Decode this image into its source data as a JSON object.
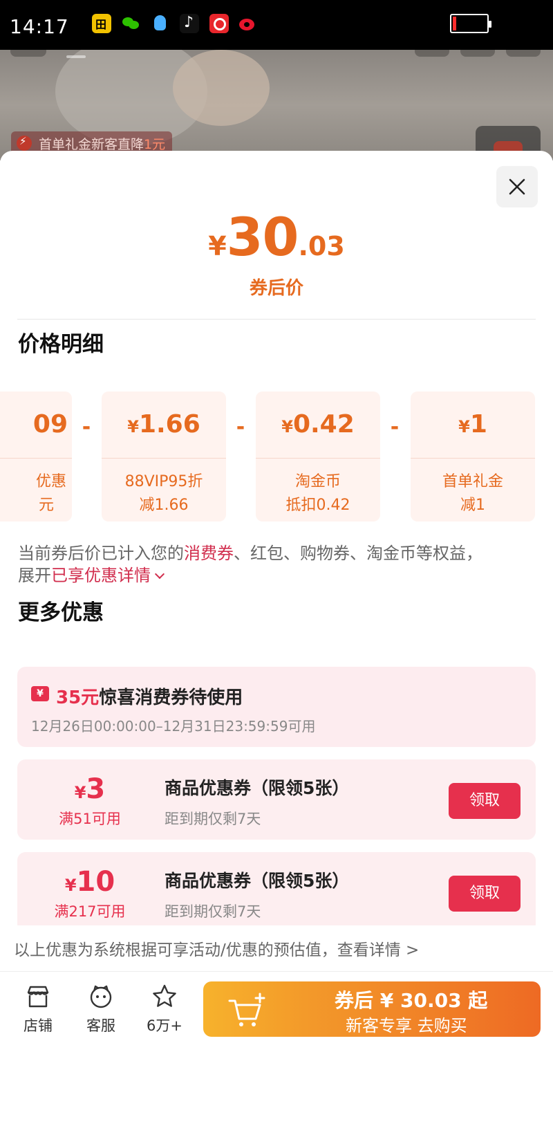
{
  "status_bar": {
    "time": "14:17"
  },
  "background": {
    "promo_tag_text": "首单礼金新客直降",
    "promo_tag_amount": "1元"
  },
  "price_summary": {
    "currency": "¥",
    "integer": "30",
    "decimal": ".03",
    "label": "券后价"
  },
  "detail": {
    "title": "价格明细",
    "cards": [
      {
        "value": "09",
        "line1": "优惠",
        "line2": "元"
      },
      {
        "value": "1.66",
        "currency": "¥",
        "line1": "88VIP95折",
        "line2": "减1.66"
      },
      {
        "value": "0.42",
        "currency": "¥",
        "line1": "淘金币",
        "line2": "抵扣0.42"
      },
      {
        "value": "1",
        "currency": "¥",
        "line1": "首单礼金",
        "line2": "减1"
      }
    ],
    "operator": "-"
  },
  "note": {
    "part1": "当前券后价已计入您的",
    "highlight1": "消费券",
    "part2": "、红包、购物券、淘金币等权益，",
    "part3": "展开",
    "highlight2": "已享优惠详情"
  },
  "more": {
    "title": "更多优惠",
    "surprise": {
      "ticket_symbol": "¥",
      "amount": "35元",
      "title": "惊喜消费券待使用",
      "period": "12月26日00:00:00–12月31日23:59:59可用"
    },
    "coupons": [
      {
        "currency": "¥",
        "value": "3",
        "condition": "满51可用",
        "title": "商品优惠券（限领5张）",
        "expiry": "距到期仅剩7天",
        "button": "领取"
      },
      {
        "currency": "¥",
        "value": "10",
        "condition": "满217可用",
        "title": "商品优惠券（限领5张）",
        "expiry": "距到期仅剩7天",
        "button": "领取"
      }
    ]
  },
  "disclaimer": "以上优惠为系统根据可享活动/优惠的预估值，查看详情 >",
  "bottom_bar": {
    "store": "店铺",
    "service": "客服",
    "favorites": "6万+",
    "buy_line1": "券后 ¥ 30.03 起",
    "buy_line2": "新客专享  去购买"
  },
  "colors": {
    "price_orange": "#e66a1f",
    "coupon_red": "#e6304d",
    "highlight_red": "#d12d4d"
  }
}
